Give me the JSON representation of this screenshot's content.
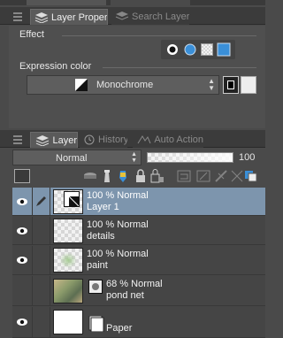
{
  "top_panel": {
    "tabs": [
      {
        "label": "Layer Property",
        "active": true
      },
      {
        "label": "Search Layer",
        "active": false
      }
    ],
    "effect_label": "Effect",
    "effect_icons": [
      "circle-black-icon",
      "circle-blue-icon",
      "checker-pattern-icon",
      "square-blue-icon"
    ],
    "expression_color_label": "Expression color",
    "expression_color_value": "Monochrome",
    "colors": {
      "accent_blue": "#3a8fd8",
      "selected_row": "#7d95ad"
    }
  },
  "layer_panel": {
    "tabs": [
      {
        "label": "Layer",
        "active": true
      },
      {
        "label": "History",
        "active": false
      },
      {
        "label": "Auto Action",
        "active": false
      }
    ],
    "blend_mode": "Normal",
    "opacity_value": "100",
    "layers": [
      {
        "opacity": "100 %",
        "blend": "Normal",
        "name": "Layer 1",
        "selected": true,
        "visible": true,
        "pen": true
      },
      {
        "opacity": "100 %",
        "blend": "Normal",
        "name": "details",
        "selected": false,
        "visible": true,
        "pen": false
      },
      {
        "opacity": "100 %",
        "blend": "Normal",
        "name": "paint",
        "selected": false,
        "visible": true,
        "pen": false
      },
      {
        "opacity": "68 %",
        "blend": "Normal",
        "name": "pond net",
        "selected": false,
        "visible": false,
        "pen": false
      },
      {
        "opacity": "",
        "blend": "",
        "name": "Paper",
        "selected": false,
        "visible": true,
        "pen": false
      }
    ]
  }
}
